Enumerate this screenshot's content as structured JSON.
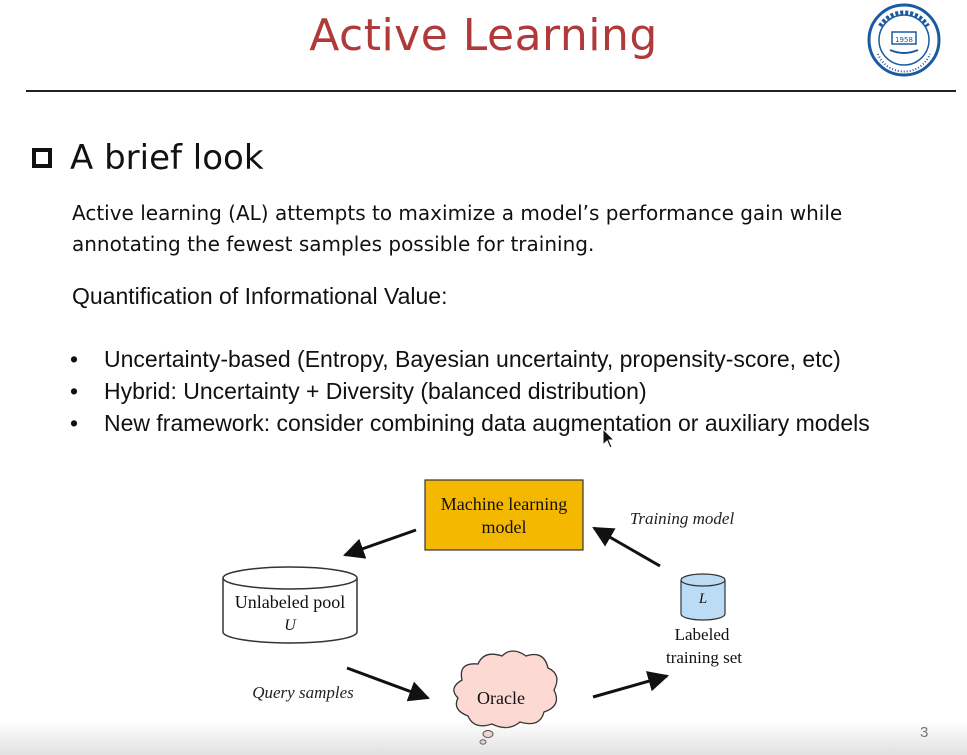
{
  "slide": {
    "title": "Active Learning",
    "logo_icon": "university-seal-icon",
    "logo_text": "1958",
    "section_title": "A brief look",
    "intro": "Active learning (AL) attempts to maximize a model’s performance gain while annotating the fewest samples possible for training.",
    "quantification_heading": "Quantification of Informational Value:",
    "bullets": [
      "Uncertainty-based (Entropy, Bayesian uncertainty, propensity-score, etc)",
      "Hybrid: Uncertainty + Diversity (balanced distribution)",
      "New framework: consider combining data augmentation or auxiliary models"
    ],
    "page_number": "3"
  },
  "diagram": {
    "model_box": {
      "line1": "Machine learning",
      "line2": "model",
      "color": "#f5b800"
    },
    "unlabeled_pool": {
      "line1": "Unlabeled pool",
      "line2": "U"
    },
    "labeled_set": {
      "symbol": "L",
      "caption1": "Labeled",
      "caption2": "training set",
      "color": "#bcdcf5"
    },
    "oracle": {
      "label": "Oracle",
      "color": "#fcd9d2"
    },
    "training_model_label": "Training model",
    "query_samples_label": "Query samples"
  }
}
